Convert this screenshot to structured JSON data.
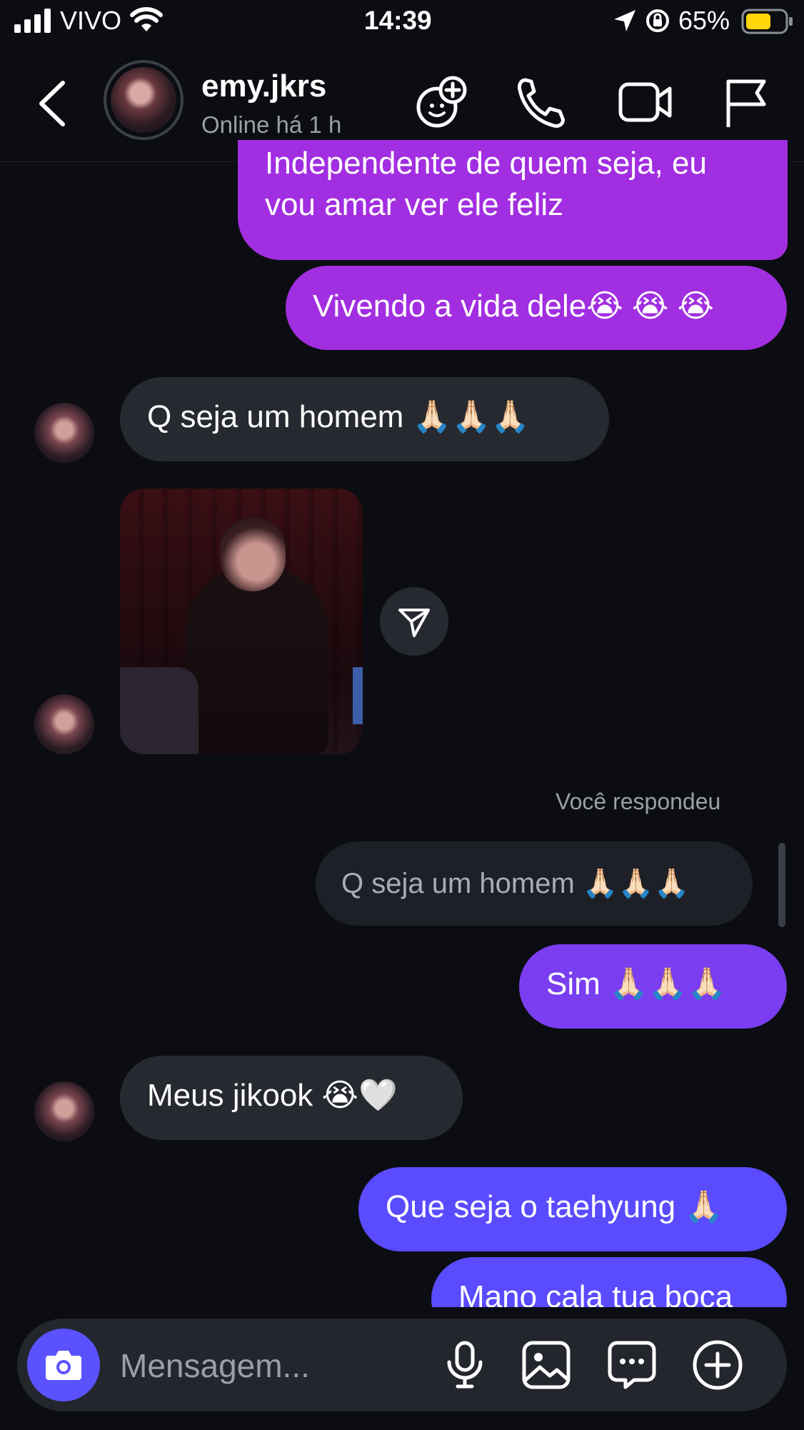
{
  "status_bar": {
    "carrier": "VIVO",
    "time": "14:39",
    "battery": "65%"
  },
  "header": {
    "username": "emy.jkrs",
    "status": "Online há 1 h"
  },
  "messages": {
    "m1": "Independente de quem seja, eu vou amar ver ele feliz",
    "m2": "Vivendo a vida dele😭 😭 😭",
    "m3": "Q seja um homem 🙏🏻🙏🏻🙏🏻",
    "reply_label": "Você respondeu",
    "reply_quote": "Q seja um homem 🙏🏻🙏🏻🙏🏻",
    "m4": "Sim 🙏🏻🙏🏻🙏🏻",
    "m5": "Meus jikook 😭🤍",
    "m6": "Que seja o taehyung 🙏🏻",
    "m7": "Mano cala tua boca"
  },
  "composer": {
    "placeholder": "Mensagem..."
  },
  "colors": {
    "background": "#0b0d12",
    "incoming_bubble": "#262930",
    "outgoing_magenta": "#a12ee0",
    "outgoing_violet": "#7a3ef0",
    "outgoing_blue": "#5a4bff",
    "camera_button": "#5b52ff"
  },
  "icons": [
    "back-icon",
    "add-people-icon",
    "phone-icon",
    "video-icon",
    "flag-icon",
    "share-icon",
    "camera-icon",
    "mic-icon",
    "gallery-icon",
    "sticker-icon",
    "plus-icon"
  ]
}
